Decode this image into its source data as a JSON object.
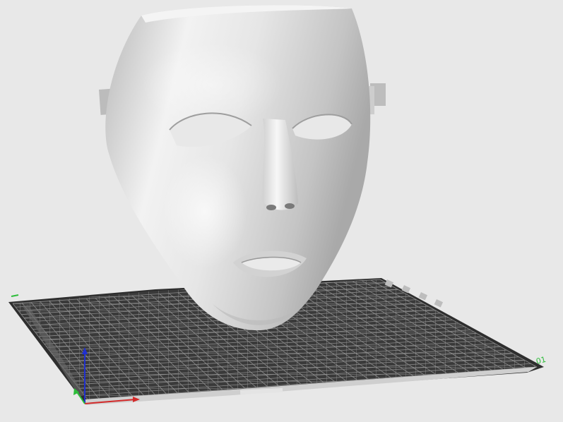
{
  "viewport": {
    "background": "#e8e8e8"
  },
  "model": {
    "icon": "face-mask-model",
    "color": "#d8d8d8"
  },
  "build_plate": {
    "icon": "build-plate-grid",
    "plate_color": "#3a3a3a",
    "grid_color": "#8a8a8a"
  },
  "axes": {
    "x_color": "#d22a2a",
    "y_color": "#2dbd3a",
    "z_color": "#1f2fd0"
  },
  "labels": {
    "corner_right": "01"
  }
}
